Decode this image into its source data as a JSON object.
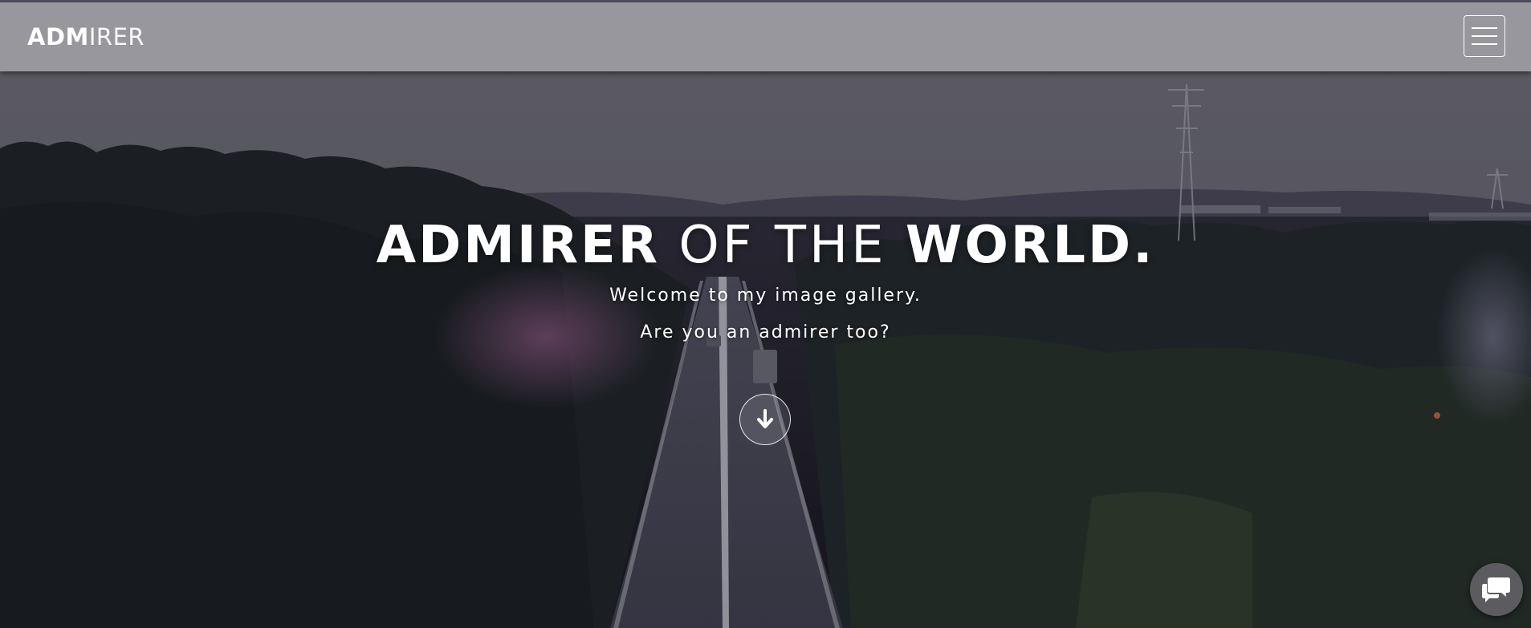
{
  "header": {
    "brand_bold": "ADM",
    "brand_light": "IRER",
    "menu_icon": "hamburger-menu-icon"
  },
  "hero": {
    "title_bold_1": "ADMIRER",
    "title_light": "OF THE",
    "title_bold_2": "WORLD.",
    "subtitle_1": "Welcome to my image gallery.",
    "subtitle_2": "Are you an admirer too?",
    "scroll_icon": "arrow-down-icon"
  },
  "chat": {
    "icon": "chat-bubbles-icon"
  },
  "colors": {
    "header_bg": "#afafb4",
    "accent": "#ffffff",
    "chat_bg": "#5b5b60"
  }
}
